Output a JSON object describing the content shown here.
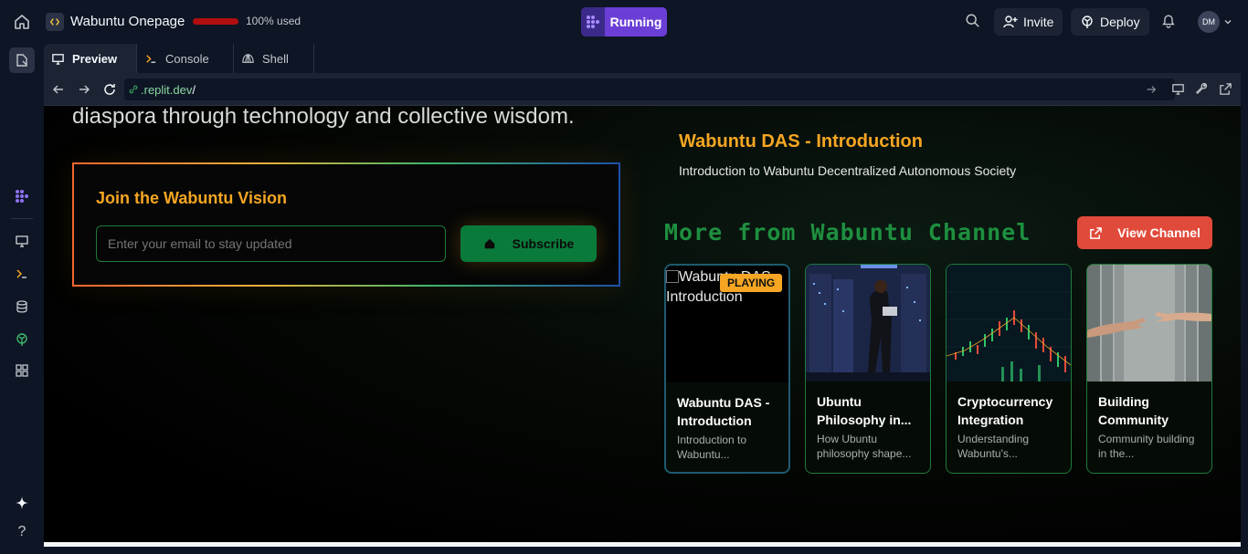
{
  "topbar": {
    "project_name": "Wabuntu Onepage",
    "usage_text": "100% used",
    "run_status": "Running",
    "invite_label": "Invite",
    "deploy_label": "Deploy",
    "avatar_initials": "DM"
  },
  "tabs": [
    {
      "label": "Preview",
      "icon": "monitor-icon"
    },
    {
      "label": "Console",
      "icon": "terminal-icon"
    },
    {
      "label": "Shell",
      "icon": "shell-icon"
    }
  ],
  "url": {
    "domain": ".replit.dev",
    "path": "/"
  },
  "page": {
    "hero_text": "diaspora through technology and collective wisdom.",
    "join": {
      "title": "Join the Wabuntu Vision",
      "email_placeholder": "Enter your email to stay updated",
      "subscribe_label": "Subscribe"
    },
    "now_playing": {
      "title": "Wabuntu DAS - Introduction",
      "subtitle": "Introduction to Wabuntu Decentralized Autonomous Society"
    },
    "more": {
      "heading": "More from Wabuntu Channel",
      "view_channel_label": "View Channel"
    },
    "videos": [
      {
        "title": "Wabuntu DAS - Introduction",
        "desc": "Introduction to Wabuntu...",
        "alt": "Wabuntu DAS - Introduction",
        "badge": "PLAYING"
      },
      {
        "title": "Ubuntu Philosophy in...",
        "desc": "How Ubuntu philosophy shape..."
      },
      {
        "title": "Cryptocurrency Integration",
        "desc": "Understanding Wabuntu's..."
      },
      {
        "title": "Building Community",
        "desc": "Community building in the..."
      }
    ]
  },
  "colors": {
    "accent_orange": "#f6a623",
    "channel_green": "#1e8f3f",
    "view_channel_red": "#e04a3a",
    "running_purple": "#6b3fd6"
  }
}
